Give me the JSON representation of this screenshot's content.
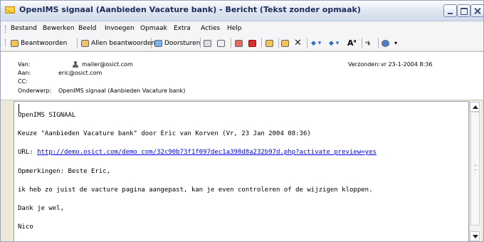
{
  "window": {
    "title": "OpenIMS signaal (Aanbieden Vacature bank) - Bericht (Tekst zonder opmaak)",
    "icon": "envelope-icon"
  },
  "menu": [
    {
      "label": "Bestand"
    },
    {
      "label": "Bewerken"
    },
    {
      "label": "Beeld"
    },
    {
      "label": "Invoegen"
    },
    {
      "label": "Opmaak"
    },
    {
      "label": "Extra"
    },
    {
      "label": "Acties"
    },
    {
      "label": "Help"
    }
  ],
  "toolbar": {
    "reply_label": "Beantwoorden",
    "reply_all_label": "Allen beantwoorden",
    "forward_label": "Doorsturen",
    "icons": [
      "reply-icon",
      "reply-all-icon",
      "forward-icon",
      "print-icon",
      "copy-icon",
      "send-receive-icon",
      "flag-icon",
      "move-icon",
      "address-book-icon",
      "delete-icon",
      "previous-icon",
      "next-icon",
      "font-size-icon",
      "spelling-icon",
      "help-icon"
    ]
  },
  "header": {
    "from_label": "Van:",
    "from_value": "mailer@osict.com",
    "to_label": "Aan:",
    "to_value": "eric@osict.com",
    "cc_label": "CC:",
    "cc_value": "",
    "subject_label": "Onderwerp:",
    "subject_value": "OpenIMS signaal (Aanbieden Vacature bank)",
    "sent_label": "Verzonden:",
    "sent_value": "vr 23-1-2004 8:36"
  },
  "body": {
    "line1": "OpenIMS SIGNAAL",
    "line2": "Keuze \"Aanbieden Vacature bank\" door Eric van Korven (Vr, 23 Jan 2004 08:36)",
    "url_label": "URL: ",
    "url": "http://demo.osict.com/demo_com/32c90b73f1f097dec1a398d8a232b97d.php?activate_preview=yes",
    "remarks": "Opmerkingen: Beste Eric,",
    "message": "ik heb zo juist de vacture pagina aangepast, kan je even controleren of de wijzigen kloppen.",
    "thanks": "Dank je wel,",
    "signature": "Nico"
  }
}
